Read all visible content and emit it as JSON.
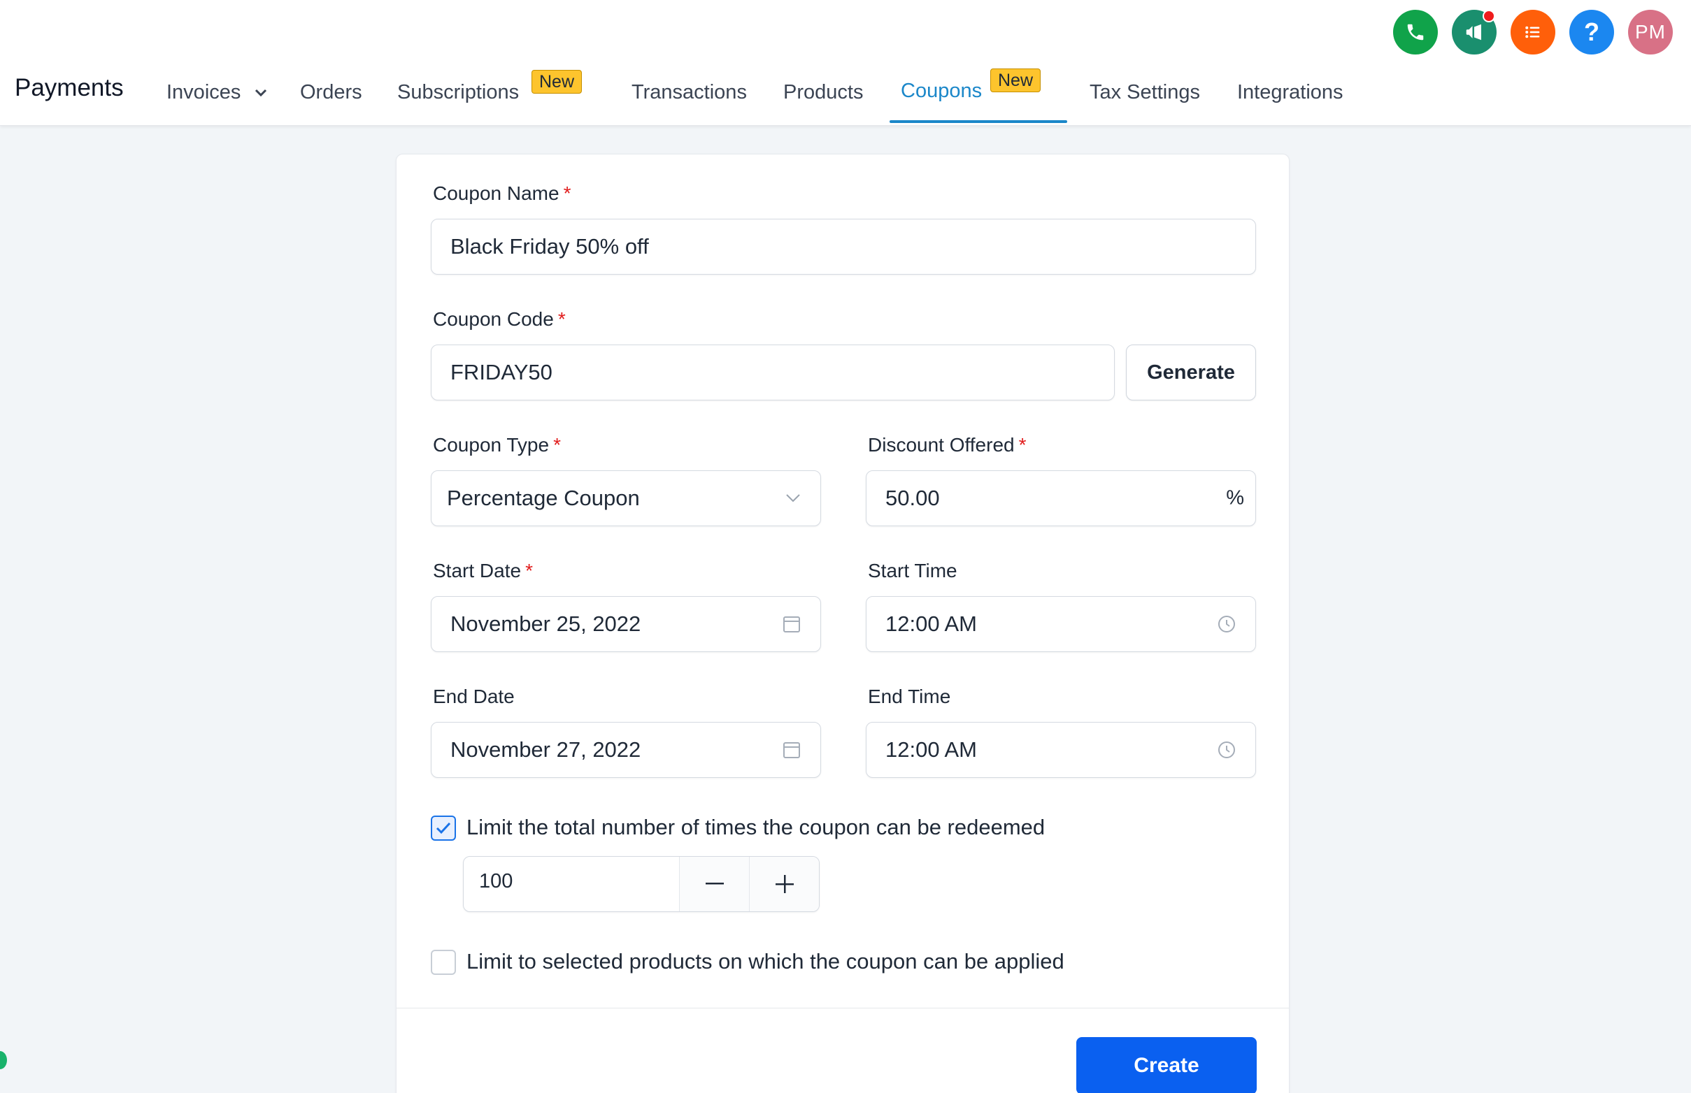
{
  "header": {
    "app_title": "Payments",
    "icons": [
      {
        "name": "phone-icon",
        "color": "#10a34a"
      },
      {
        "name": "megaphone-icon",
        "color": "#1a8f6e"
      },
      {
        "name": "list-icon",
        "color": "#ff5f0a"
      },
      {
        "name": "help-icon",
        "color": "#1b87f0",
        "label": "?"
      },
      {
        "name": "avatar",
        "color": "#d87186",
        "label": "PM"
      }
    ],
    "nav": {
      "invoices": "Invoices",
      "orders": "Orders",
      "subscriptions": "Subscriptions",
      "subscriptions_badge": "New",
      "transactions": "Transactions",
      "products": "Products",
      "coupons": "Coupons",
      "coupons_badge": "New",
      "tax_settings": "Tax Settings",
      "integrations": "Integrations"
    },
    "active_tab": "Coupons"
  },
  "form": {
    "coupon_name": {
      "label": "Coupon Name",
      "required_mark": "*",
      "value": "Black Friday 50% off"
    },
    "coupon_code": {
      "label": "Coupon Code",
      "required_mark": "*",
      "value": "FRIDAY50",
      "generate_label": "Generate"
    },
    "coupon_type": {
      "label": "Coupon Type",
      "required_mark": "*",
      "value": "Percentage Coupon"
    },
    "discount_offered": {
      "label": "Discount Offered",
      "required_mark": "*",
      "value": "50.00",
      "unit": "%"
    },
    "start_date": {
      "label": "Start Date",
      "required_mark": "*",
      "value": "November 25, 2022"
    },
    "start_time": {
      "label": "Start Time",
      "value": "12:00 AM"
    },
    "end_date": {
      "label": "End Date",
      "value": "November 27, 2022"
    },
    "end_time": {
      "label": "End Time",
      "value": "12:00 AM"
    },
    "limit_redemptions": {
      "label": "Limit the total number of times the coupon can be redeemed",
      "checked": true,
      "value": "100"
    },
    "limit_products": {
      "label": "Limit to selected products on which the coupon can be applied",
      "checked": false
    },
    "create_label": "Create"
  },
  "colors": {
    "accent": "#1b87c9",
    "primary_button": "#0a60f0",
    "badge": "#fdc42d",
    "required": "#e11d1d"
  }
}
